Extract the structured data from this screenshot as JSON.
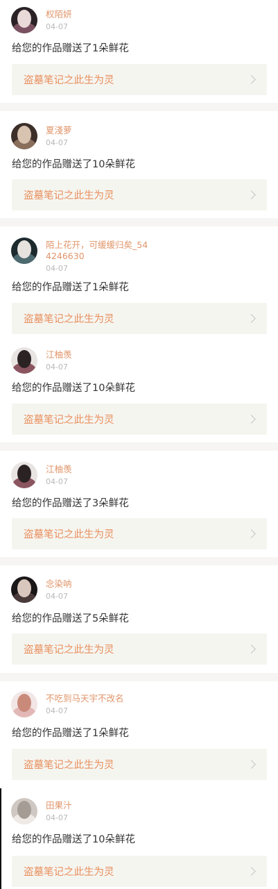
{
  "gifts": [
    {
      "username": "权陌妍",
      "date": "04-07",
      "message": "给您的作品赠送了1朵鲜花",
      "work_title": "盗墓笔记之此生为灵",
      "avatar_colors": [
        "#2a2226",
        "#e9d9d8",
        "#7a5160"
      ]
    },
    {
      "username": "夏淺萝",
      "date": "04-07",
      "message": "给您的作品赠送了10朵鲜花",
      "work_title": "盗墓笔记之此生为灵",
      "avatar_colors": [
        "#3c2f2a",
        "#d8c2b0",
        "#8a6e5c"
      ]
    },
    {
      "username": "陌上花开，可缓缓归矣_544246630",
      "date": "04-07",
      "message": "给您的作品赠送了1朵鲜花",
      "work_title": "盗墓笔记之此生为灵",
      "avatar_colors": [
        "#1d2a2e",
        "#e6e2de",
        "#4d6a70"
      ]
    },
    {
      "username": "江柚羡",
      "date": "04-07",
      "message": "给您的作品赠送了10朵鲜花",
      "work_title": "盗墓笔记之此生为灵",
      "avatar_colors": [
        "#e8e4e2",
        "#2b2224",
        "#8b5560"
      ]
    },
    {
      "username": "江柚羡",
      "date": "04-07",
      "message": "给您的作品赠送了3朵鲜花",
      "work_title": "盗墓笔记之此生为灵",
      "avatar_colors": [
        "#e8e4e2",
        "#2b2224",
        "#8b5560"
      ]
    },
    {
      "username": "念染呐",
      "date": "04-07",
      "message": "给您的作品赠送了5朵鲜花",
      "work_title": "盗墓笔记之此生为灵",
      "avatar_colors": [
        "#1b1718",
        "#d9c6bd",
        "#4a3a3a"
      ]
    },
    {
      "username": "不吃到马天宇不改名",
      "date": "04-07",
      "message": "给您的作品赠送了1朵鲜花",
      "work_title": "盗墓笔记之此生为灵",
      "avatar_colors": [
        "#f2e6e6",
        "#c98a7a",
        "#e2b8b6"
      ]
    },
    {
      "username": "田果汁",
      "date": "04-07",
      "message": "给您的作品赠送了10朵鲜花",
      "work_title": "盗墓笔记之此生为灵",
      "avatar_colors": [
        "#cfc8c2",
        "#a59c96",
        "#efeae6"
      ]
    }
  ],
  "colors": {
    "username": "#e0956a",
    "work_title": "#e8905f",
    "card_bg": "#f5f5f0",
    "divider": "#f7f5f3"
  }
}
